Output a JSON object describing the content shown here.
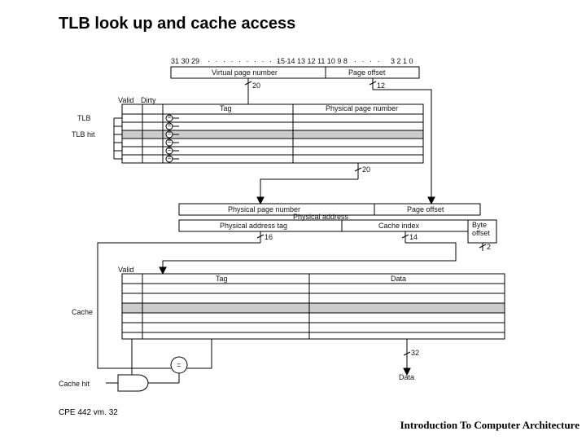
{
  "title": "TLB look up and cache access",
  "footer_left": "CPE 442 vm. 32",
  "footer_right": "Introduction To Computer Architecture",
  "va": {
    "bits_left": "31 30 29",
    "bits_mid": "15 14 13 12 11 10 9 8",
    "bits_right": "3 2 1 0",
    "vpn": "Virtual page number",
    "po": "Page offset",
    "w20": "20",
    "w12": "12"
  },
  "tlb": {
    "valid": "Valid",
    "dirty": "Dirty",
    "tag": "Tag",
    "ppn": "Physical page number",
    "label": "TLB",
    "hit": "TLB hit",
    "eq": "=",
    "out20": "20"
  },
  "pa": {
    "ppn": "Physical page number",
    "po": "Page offset",
    "label": "Physical address",
    "tag": "Physical address tag",
    "cidx": "Cache index",
    "boff": "Byte offset",
    "w16": "16",
    "w14": "14",
    "w2": "2"
  },
  "cache": {
    "valid": "Valid",
    "tag": "Tag",
    "data": "Data",
    "label": "Cache",
    "hit": "Cache hit",
    "eq": "=",
    "w32": "32",
    "out": "Data"
  }
}
